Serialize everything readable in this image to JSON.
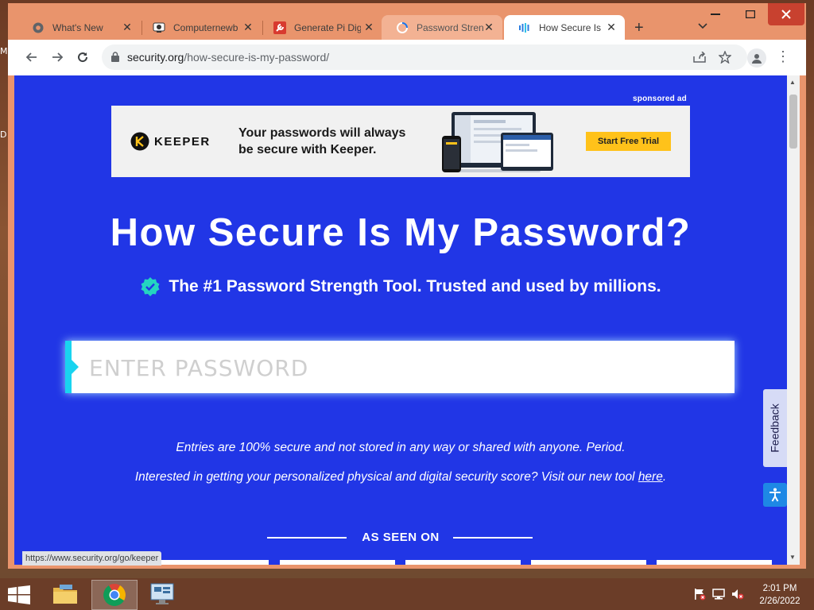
{
  "desktop": {
    "edge_letters": [
      "M",
      "D"
    ]
  },
  "browser": {
    "tabs": [
      {
        "title": "What's New",
        "favicon": "chrome-icon"
      },
      {
        "title": "Computernewb",
        "favicon": "computernewb-icon"
      },
      {
        "title": "Generate Pi Digits",
        "favicon": "wrench-icon"
      },
      {
        "title": "Password Strength",
        "favicon": "loading-spinner-icon"
      },
      {
        "title": "How Secure Is My",
        "favicon": "security-org-icon"
      }
    ],
    "close_glyph": "✕",
    "new_tab_glyph": "+",
    "url_domain": "security.org",
    "url_path": "/how-secure-is-my-password/",
    "status_url": "https://www.security.org/go/keeper"
  },
  "ad": {
    "sponsored_label": "sponsored ad",
    "brand": "KEEPER",
    "headline_line1": "Your passwords will always",
    "headline_line2": "be secure with Keeper.",
    "cta": "Start Free Trial"
  },
  "page": {
    "title": "How Secure Is My Password?",
    "subtitle": "The #1 Password Strength Tool. Trusted and used by millions.",
    "password_placeholder": "ENTER PASSWORD",
    "note1": "Entries are 100% secure and not stored in any way or shared with anyone. Period.",
    "note2_text": "Interested in getting your personalized physical and digital security score? Visit our new tool ",
    "note2_link": "here",
    "note2_end": ".",
    "as_seen_on": "AS SEEN ON",
    "feedback": "Feedback"
  },
  "taskbar": {
    "time": "2:01 PM",
    "date": "2/26/2022"
  },
  "colors": {
    "page_bg": "#2136e6",
    "tabbar_bg": "#e9946c",
    "accent_cyan": "#19d4f0",
    "cta_yellow": "#ffc21a"
  }
}
